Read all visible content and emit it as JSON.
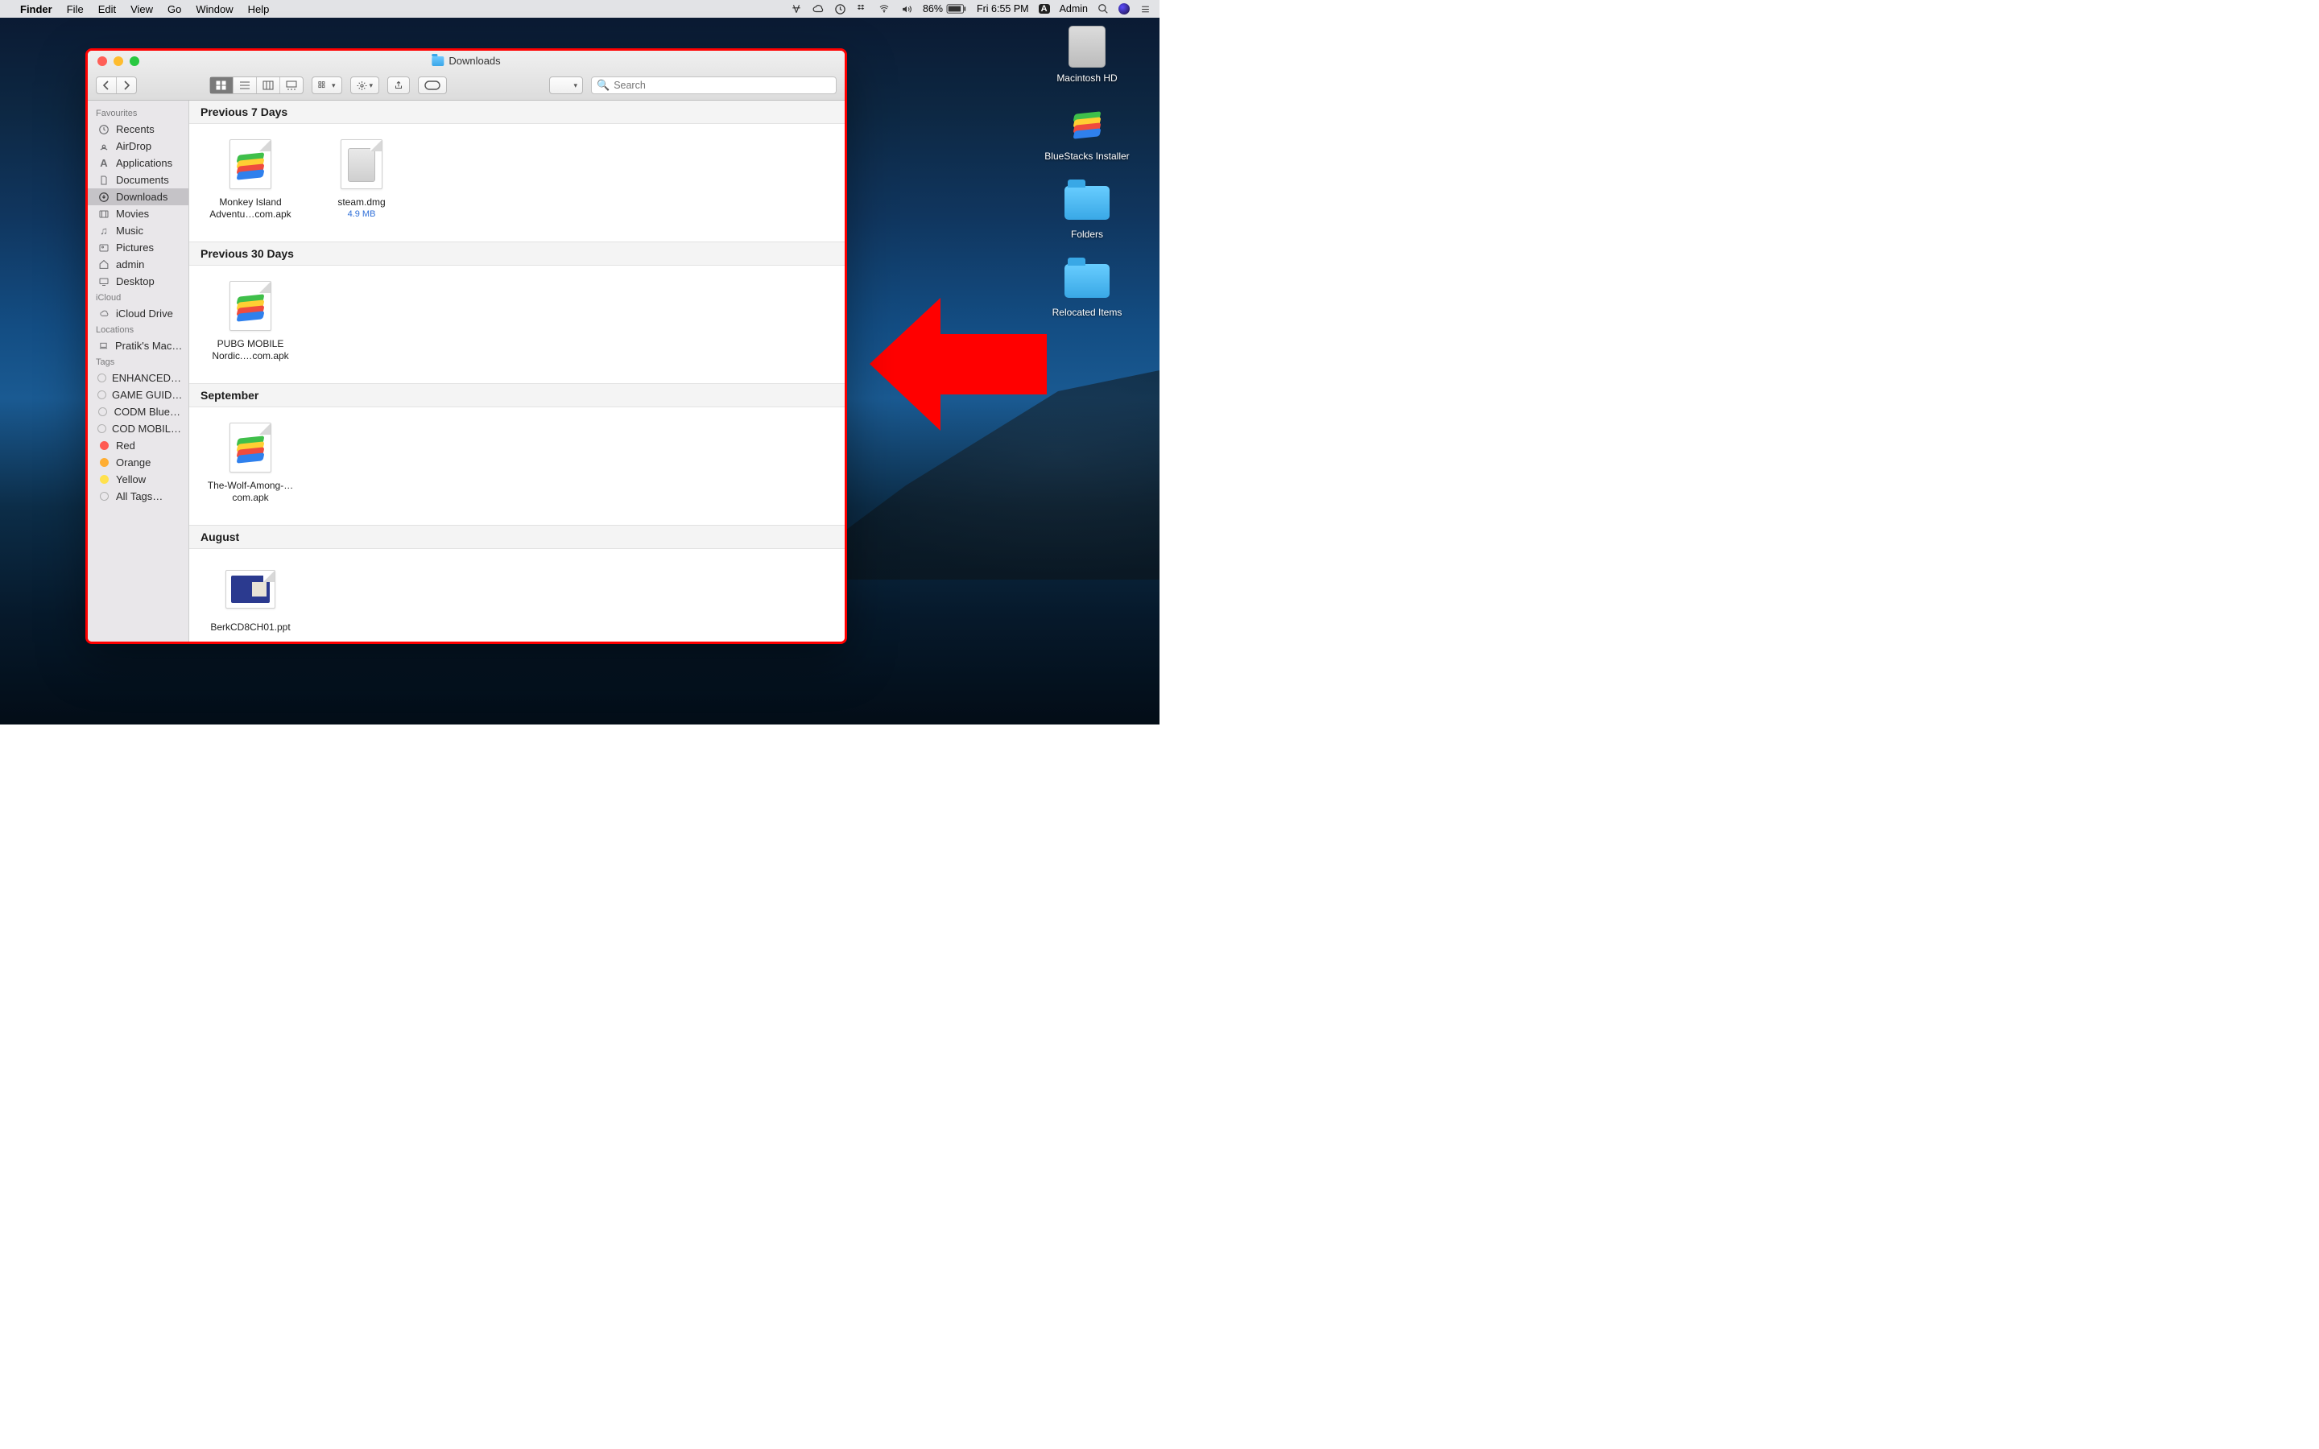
{
  "menubar": {
    "app": "Finder",
    "items": [
      "File",
      "Edit",
      "View",
      "Go",
      "Window",
      "Help"
    ],
    "battery_pct": "86%",
    "clock": "Fri 6:55 PM",
    "user": "Admin",
    "user_badge": "A"
  },
  "desktop_items": [
    {
      "name": "Macintosh HD",
      "kind": "hdd"
    },
    {
      "name": "BlueStacks Installer",
      "kind": "bluestacks"
    },
    {
      "name": "Folders",
      "kind": "folder"
    },
    {
      "name": "Relocated Items",
      "kind": "folder"
    }
  ],
  "window": {
    "title": "Downloads",
    "search_placeholder": "Search",
    "sidebar": {
      "sections": [
        {
          "header": "Favourites",
          "items": [
            {
              "label": "Recents",
              "icon": "clock"
            },
            {
              "label": "AirDrop",
              "icon": "airdrop"
            },
            {
              "label": "Applications",
              "icon": "apps"
            },
            {
              "label": "Documents",
              "icon": "doc"
            },
            {
              "label": "Downloads",
              "icon": "download",
              "selected": true
            },
            {
              "label": "Movies",
              "icon": "movie"
            },
            {
              "label": "Music",
              "icon": "music"
            },
            {
              "label": "Pictures",
              "icon": "picture"
            },
            {
              "label": "admin",
              "icon": "home"
            },
            {
              "label": "Desktop",
              "icon": "desktop"
            }
          ]
        },
        {
          "header": "iCloud",
          "items": [
            {
              "label": "iCloud Drive",
              "icon": "cloud"
            }
          ]
        },
        {
          "header": "Locations",
          "items": [
            {
              "label": "Pratik's Mac…",
              "icon": "laptop"
            }
          ]
        },
        {
          "header": "Tags",
          "items": [
            {
              "label": "ENHANCED…",
              "icon": "tag"
            },
            {
              "label": "GAME GUID…",
              "icon": "tag"
            },
            {
              "label": "CODM Blue…",
              "icon": "tag"
            },
            {
              "label": "COD MOBIL…",
              "icon": "tag"
            },
            {
              "label": "Red",
              "icon": "tag",
              "color": "red"
            },
            {
              "label": "Orange",
              "icon": "tag",
              "color": "orange"
            },
            {
              "label": "Yellow",
              "icon": "tag",
              "color": "yellow"
            },
            {
              "label": "All Tags…",
              "icon": "tag"
            }
          ]
        }
      ]
    },
    "groups": [
      {
        "title": "Previous 7 Days",
        "files": [
          {
            "name": "Monkey Island Adventu…com.apk",
            "kind": "apk"
          },
          {
            "name": "steam.dmg",
            "kind": "dmg",
            "meta": "4.9 MB"
          }
        ]
      },
      {
        "title": "Previous 30 Days",
        "files": [
          {
            "name": "PUBG MOBILE Nordic.…com.apk",
            "kind": "apk"
          }
        ]
      },
      {
        "title": "September",
        "files": [
          {
            "name": "The-Wolf-Among-…com.apk",
            "kind": "apk"
          }
        ]
      },
      {
        "title": "August",
        "files": [
          {
            "name": "BerkCD8CH01.ppt",
            "kind": "ppt"
          }
        ]
      }
    ]
  }
}
